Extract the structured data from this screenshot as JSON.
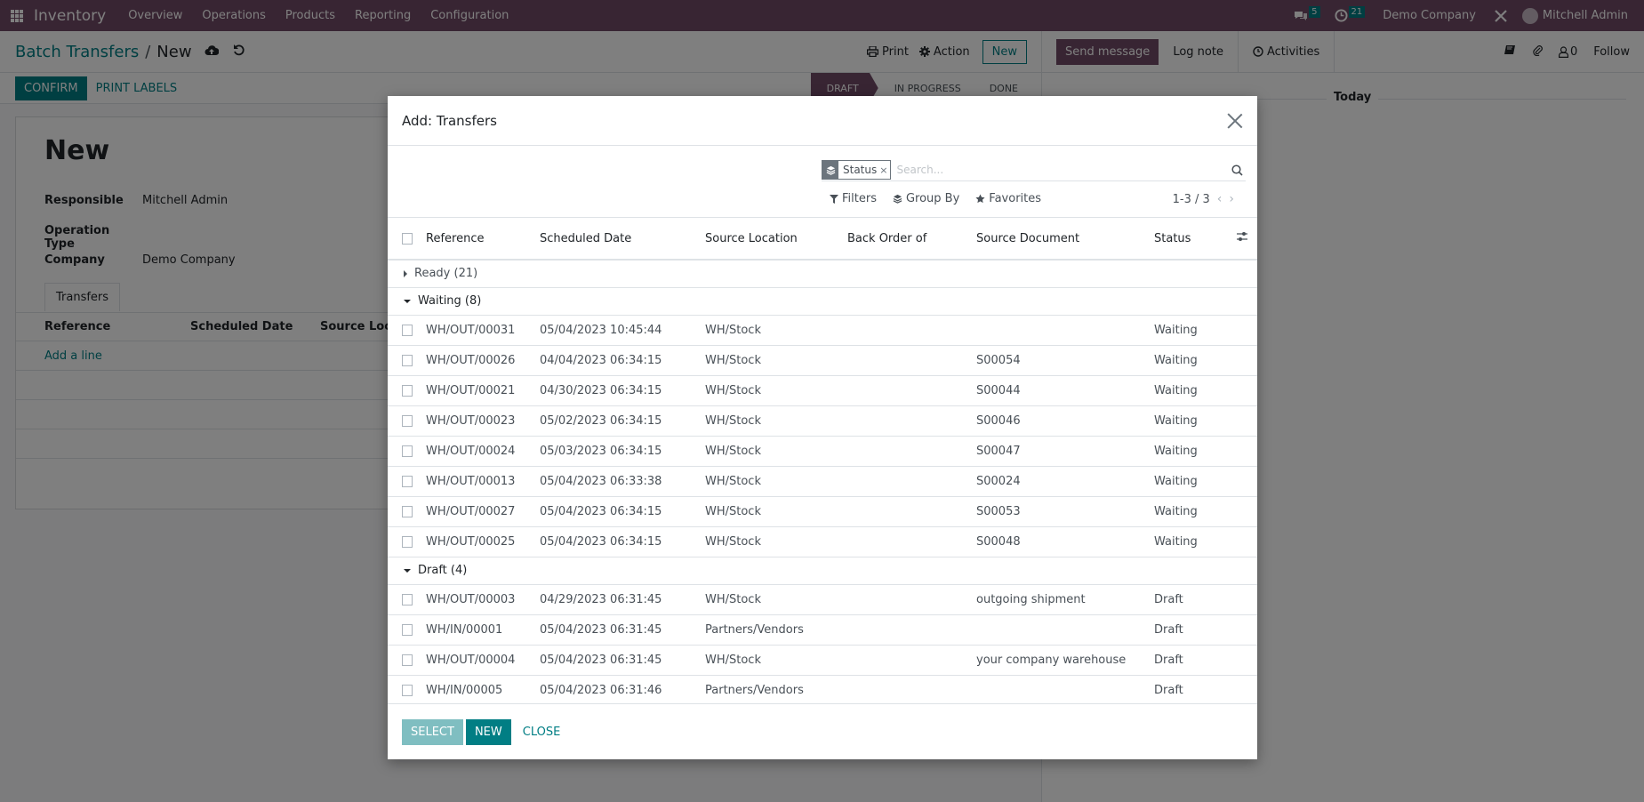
{
  "navbar": {
    "app_name": "Inventory",
    "menu": [
      "Overview",
      "Operations",
      "Products",
      "Reporting",
      "Configuration"
    ],
    "messages_count": "5",
    "activities_count": "21",
    "company": "Demo Company",
    "user": "Mitchell Admin",
    "icons": {
      "apps": "apps-grid-icon",
      "messages": "chat-icon",
      "activities": "clock-icon",
      "debug": "tools-icon"
    }
  },
  "control_panel": {
    "breadcrumb_parent": "Batch Transfers",
    "breadcrumb_separator": "/",
    "breadcrumb_current": "New",
    "print_label": "Print",
    "action_label": "Action",
    "new_label": "New"
  },
  "statusbar": {
    "confirm_label": "CONFIRM",
    "print_labels_label": "PRINT LABELS",
    "stages": [
      {
        "label": "DRAFT",
        "active": true
      },
      {
        "label": "IN PROGRESS",
        "active": false
      },
      {
        "label": "DONE",
        "active": false
      }
    ]
  },
  "form": {
    "record_name": "New",
    "fields": [
      {
        "label": "Responsible",
        "value": "Mitchell Admin"
      },
      {
        "label": "Operation Type",
        "value": ""
      },
      {
        "label": "Company",
        "value": "Demo Company"
      }
    ],
    "tab_label": "Transfers",
    "subtable_columns": [
      "Reference",
      "Scheduled Date",
      "Source Locat"
    ],
    "add_line_label": "Add a line"
  },
  "chatter": {
    "send_message_label": "Send message",
    "log_note_label": "Log note",
    "activities_label": "Activities",
    "followers_count": "0",
    "follow_label": "Follow",
    "today_label": "Today"
  },
  "modal": {
    "title": "Add: Transfers",
    "search": {
      "facet_label": "Status",
      "placeholder": "Search..."
    },
    "filters_label": "Filters",
    "group_by_label": "Group By",
    "favorites_label": "Favorites",
    "pager_value": "1-3 / 3",
    "columns": [
      "Reference",
      "Scheduled Date",
      "Source Location",
      "Back Order of",
      "Source Document",
      "Status"
    ],
    "groups": [
      {
        "label": "Ready (21)",
        "open": false,
        "rows": []
      },
      {
        "label": "Waiting (8)",
        "open": true,
        "rows": [
          {
            "reference": "WH/OUT/00031",
            "scheduled_date": "05/04/2023 10:45:44",
            "source_location": "WH/Stock",
            "back_order_of": "",
            "source_document": "",
            "status": "Waiting"
          },
          {
            "reference": "WH/OUT/00026",
            "scheduled_date": "04/04/2023 06:34:15",
            "source_location": "WH/Stock",
            "back_order_of": "",
            "source_document": "S00054",
            "status": "Waiting"
          },
          {
            "reference": "WH/OUT/00021",
            "scheduled_date": "04/30/2023 06:34:15",
            "source_location": "WH/Stock",
            "back_order_of": "",
            "source_document": "S00044",
            "status": "Waiting"
          },
          {
            "reference": "WH/OUT/00023",
            "scheduled_date": "05/02/2023 06:34:15",
            "source_location": "WH/Stock",
            "back_order_of": "",
            "source_document": "S00046",
            "status": "Waiting"
          },
          {
            "reference": "WH/OUT/00024",
            "scheduled_date": "05/03/2023 06:34:15",
            "source_location": "WH/Stock",
            "back_order_of": "",
            "source_document": "S00047",
            "status": "Waiting"
          },
          {
            "reference": "WH/OUT/00013",
            "scheduled_date": "05/04/2023 06:33:38",
            "source_location": "WH/Stock",
            "back_order_of": "",
            "source_document": "S00024",
            "status": "Waiting"
          },
          {
            "reference": "WH/OUT/00027",
            "scheduled_date": "05/04/2023 06:34:15",
            "source_location": "WH/Stock",
            "back_order_of": "",
            "source_document": "S00053",
            "status": "Waiting"
          },
          {
            "reference": "WH/OUT/00025",
            "scheduled_date": "05/04/2023 06:34:15",
            "source_location": "WH/Stock",
            "back_order_of": "",
            "source_document": "S00048",
            "status": "Waiting"
          }
        ]
      },
      {
        "label": "Draft (4)",
        "open": true,
        "rows": [
          {
            "reference": "WH/OUT/00003",
            "scheduled_date": "04/29/2023 06:31:45",
            "source_location": "WH/Stock",
            "back_order_of": "",
            "source_document": "outgoing shipment",
            "status": "Draft"
          },
          {
            "reference": "WH/IN/00001",
            "scheduled_date": "05/04/2023 06:31:45",
            "source_location": "Partners/Vendors",
            "back_order_of": "",
            "source_document": "",
            "status": "Draft"
          },
          {
            "reference": "WH/OUT/00004",
            "scheduled_date": "05/04/2023 06:31:45",
            "source_location": "WH/Stock",
            "back_order_of": "",
            "source_document": "your company warehouse",
            "status": "Draft"
          },
          {
            "reference": "WH/IN/00005",
            "scheduled_date": "05/04/2023 06:31:46",
            "source_location": "Partners/Vendors",
            "back_order_of": "",
            "source_document": "",
            "status": "Draft"
          }
        ]
      }
    ],
    "footer": {
      "select_label": "SELECT",
      "new_label": "NEW",
      "close_label": "CLOSE"
    }
  },
  "colors": {
    "brand": "#714b67",
    "primary": "#017e84",
    "primary_disabled": "#7fbec1"
  }
}
